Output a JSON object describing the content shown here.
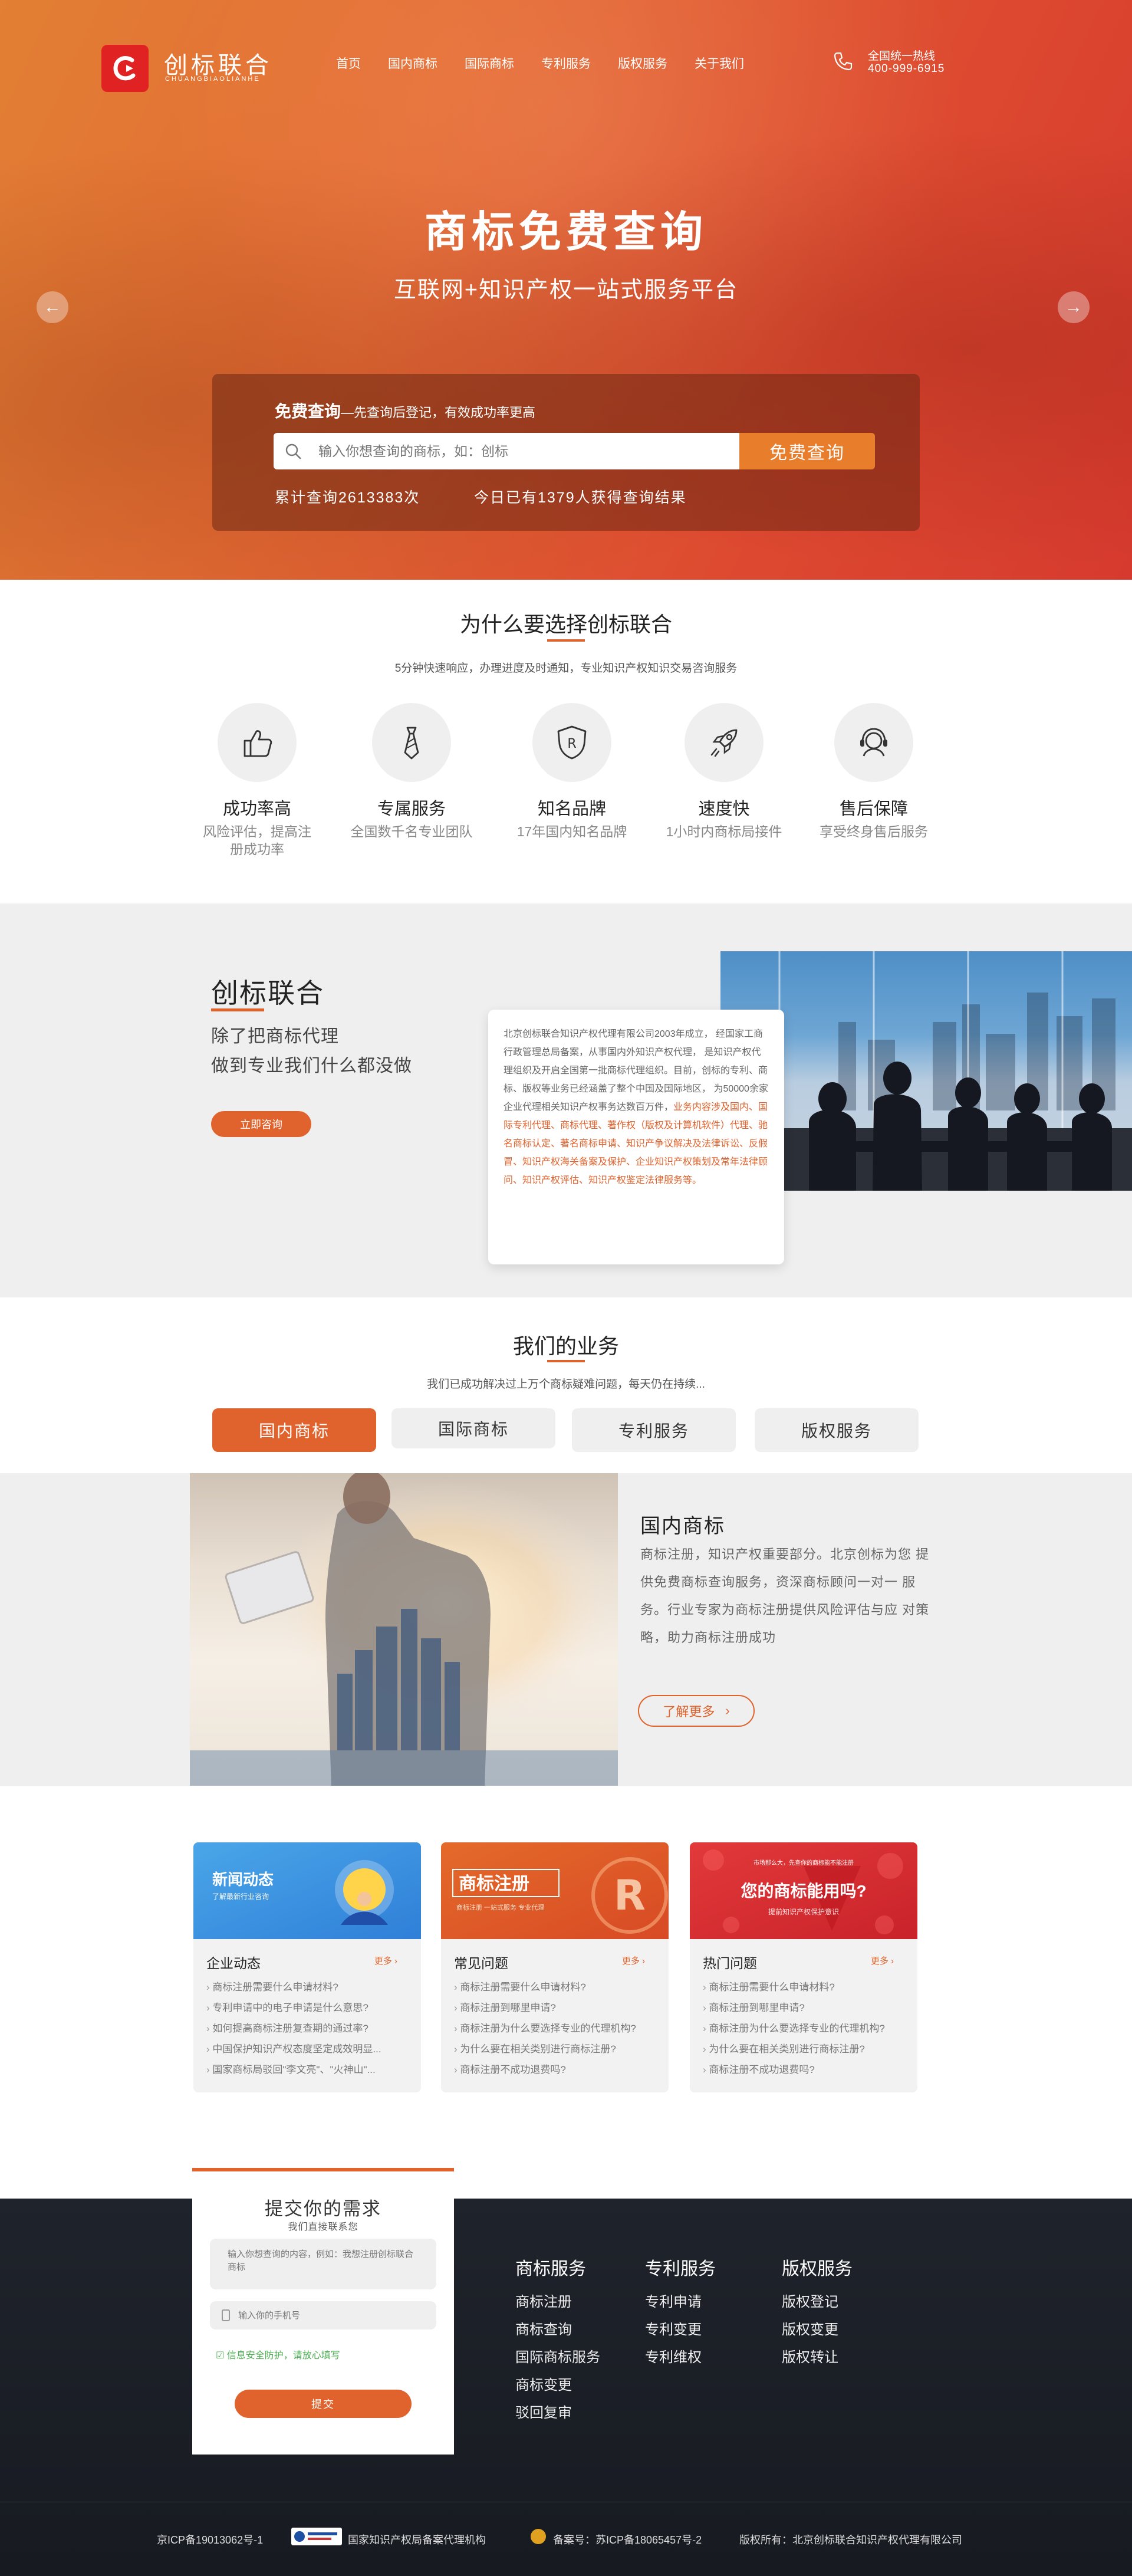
{
  "brand": {
    "name_cn": "创标联合",
    "name_en": "CHUANGBIAOLIANHE"
  },
  "nav": [
    "首页",
    "国内商标",
    "国际商标",
    "专利服务",
    "版权服务",
    "关于我们"
  ],
  "hotline": {
    "label": "全国统一热线",
    "number": "400-999-6915"
  },
  "hero": {
    "title": "商标免费查询",
    "subtitle": "互联网+知识产权一站式服务平台",
    "search_head_bold": "免费查询",
    "search_head_rest": "—先查询后登记，有效成功率更高",
    "search_placeholder": "输入你想查询的商标，如：创标",
    "search_button": "免费查询",
    "stat_total": "累计查询2613383次",
    "stat_today": "今日已有1379人获得查询结果"
  },
  "why": {
    "title": "为什么要选择创标联合",
    "desc": "5分钟快速响应，办理进度及时通知，专业知识产权知识交易咨询服务",
    "items": [
      {
        "title": "成功率高",
        "desc": "风险评估，提高注册成功率",
        "icon": "thumbs-up-icon"
      },
      {
        "title": "专属服务",
        "desc": "全国数千名专业团队",
        "icon": "tie-icon"
      },
      {
        "title": "知名品牌",
        "desc": "17年国内知名品牌",
        "icon": "shield-r-icon"
      },
      {
        "title": "速度快",
        "desc": "1小时内商标局接件",
        "icon": "rocket-icon"
      },
      {
        "title": "售后保障",
        "desc": "享受终身售后服务",
        "icon": "headset-icon"
      }
    ]
  },
  "about": {
    "title": "创标联合",
    "line1": "除了把商标代理",
    "line2": "做到专业我们什么都没做",
    "button": "立即咨询",
    "text_plain": "北京创标联合知识产权代理有限公司2003年成立， 经国家工商行政管理总局备案，从事国内外知识产权代理， 是知识产权代理组织及开启全国第一批商标代理组织。目前，创标的专利、商标、版权等业务已经涵盖了整个中国及国际地区， 为50000余家企业代理相关知识产权事务达数百万件，",
    "text_highlight": "业务内容涉及国内、国际专利代理、商标代理、著作权（版权及计算机软件）代理、驰名商标认定、著名商标申请、知识产争议解决及法律诉讼、反假冒、知识产权海关备案及保护、企业知识产权策划及常年法律顾问、知识产权评估、知识产权鉴定法律服务等。"
  },
  "business": {
    "title": "我们的业务",
    "desc": "我们已成功解决过上万个商标疑难问题，每天仍在持续...",
    "tabs": [
      "国内商标",
      "国际商标",
      "专利服务",
      "版权服务"
    ],
    "active_tab": 0,
    "panel_title": "国内商标",
    "panel_text": "商标注册，知识产权重要部分。北京创标为您 提供免费商标查询服务，资深商标顾问一对一 服务。行业专家为商标注册提供风险评估与应 对策略，助力商标注册成功",
    "panel_more": "了解更多"
  },
  "news": [
    {
      "banner_title": "新闻动态",
      "banner_sub": "了解最新行业咨询",
      "title": "企业动态",
      "more": "更多",
      "items": [
        "商标注册需要什么申请材料?",
        "专利申请中的电子申请是什么意思?",
        "如何提高商标注册复查期的通过率?",
        "中国保护知识产权态度坚定成效明显...",
        "国家商标局驳回\"李文亮\"、\"火神山\"..."
      ]
    },
    {
      "banner_title": "商标注册",
      "banner_sub": "商标注册 一站式服务 专业代理",
      "title": "常见问题",
      "more": "更多",
      "items": [
        "商标注册需要什么申请材料?",
        "商标注册到哪里申请?",
        "商标注册为什么要选择专业的代理机构?",
        "为什么要在相关类别进行商标注册?",
        "商标注册不成功退费吗?"
      ]
    },
    {
      "banner_title": "您的商标能用吗?",
      "banner_sub": "提前知识产权保护意识",
      "banner_top": "市场那么大，先查你的商标能不能注册",
      "title": "热门问题",
      "more": "更多",
      "items": [
        "商标注册需要什么申请材料?",
        "商标注册到哪里申请?",
        "商标注册为什么要选择专业的代理机构?",
        "为什么要在相关类别进行商标注册?",
        "商标注册不成功退费吗?"
      ]
    }
  ],
  "form": {
    "title": "提交你的需求",
    "subtitle": "我们直接联系您",
    "textarea_placeholder": "输入你想查询的内容，例如：我想注册创标联合商标",
    "phone_placeholder": "输入你的手机号",
    "safety_note": "信息安全防护，请放心填写",
    "submit": "提交"
  },
  "footer_cols": [
    {
      "title": "商标服务",
      "links": [
        "商标注册",
        "商标查询",
        "国际商标服务",
        "商标变更",
        "驳回复审"
      ]
    },
    {
      "title": "专利服务",
      "links": [
        "专利申请",
        "专利变更",
        "专利维权"
      ]
    },
    {
      "title": "版权服务",
      "links": [
        "版权登记",
        "版权变更",
        "版权转让"
      ]
    }
  ],
  "footer_bottom": {
    "icp": "京ICP备19013062号-1",
    "agency": "国家知识产权局备案代理机构",
    "beian": "备案号：苏ICP备18065457号-2",
    "copyright": "版权所有：北京创标联合知识产权代理有限公司"
  },
  "colors": {
    "accent": "#e0622c",
    "hero_start": "#e27f34",
    "hero_end": "#d63a2e",
    "footer": "#1c1f26"
  }
}
